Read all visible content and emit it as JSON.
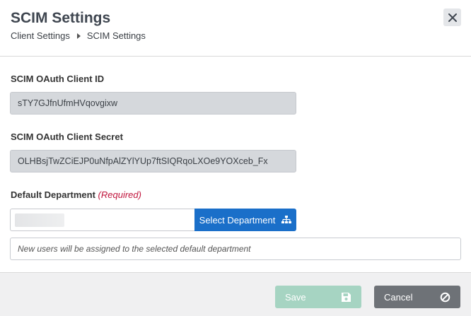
{
  "dialog": {
    "title": "SCIM Settings",
    "breadcrumb": [
      "Client Settings",
      "SCIM Settings"
    ]
  },
  "form": {
    "client_id_label": "SCIM OAuth Client ID",
    "client_id_value": "sTY7GJfnUfmHVqovgixw",
    "client_secret_label": "SCIM OAuth Client Secret",
    "client_secret_value": "OLHBsjTwZCiEJP0uNfpAlZYlYUp7ftSIQRqoLXOe9YOXceb_Fx",
    "department_label": "Default Department",
    "department_required": "(Required)",
    "department_value": "",
    "select_department_label": "Select Department",
    "info_text": "New users will be assigned to the selected default department"
  },
  "footer": {
    "save_label": "Save",
    "cancel_label": "Cancel"
  },
  "colors": {
    "primary": "#1a6fc9",
    "save_disabled": "#a6d4c2",
    "cancel": "#6e7277",
    "required": "#c0143c"
  },
  "icons": {
    "close": "close-icon",
    "breadcrumb_separator": "caret-right-icon",
    "select_department": "sitemap-icon",
    "save": "floppy-disk-icon",
    "cancel": "ban-icon"
  }
}
